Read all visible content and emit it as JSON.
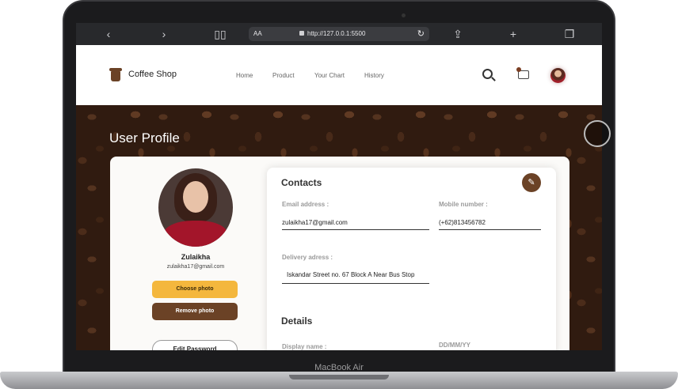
{
  "device": {
    "model": "MacBook Air"
  },
  "browser": {
    "text_size": "AA",
    "url": "http://127.0.0.1:5500"
  },
  "header": {
    "brand": "Coffee Shop",
    "links": [
      "Home",
      "Product",
      "Your Chart",
      "History"
    ]
  },
  "page": {
    "title": "User Profile"
  },
  "profile": {
    "name": "Zulaikha",
    "email": "zulaikha17@gmail.com",
    "choose_label": "Choose photo",
    "remove_label": "Remove photo",
    "password_label": "Edit Password"
  },
  "contacts": {
    "title": "Contacts",
    "email_label": "Email address :",
    "email_value": "zulaikha17@gmail.com",
    "mobile_label": "Mobile number :",
    "mobile_value": "(+62)813456782",
    "delivery_label": "Delivery adress :",
    "delivery_value": "Iskandar Street no. 67 Block A Near Bus Stop"
  },
  "details": {
    "title": "Details",
    "display_label": "Display name :",
    "date_label": "DD/MM/YY"
  },
  "colors": {
    "brown": "#6b4226",
    "accent": "#f4b73d"
  }
}
